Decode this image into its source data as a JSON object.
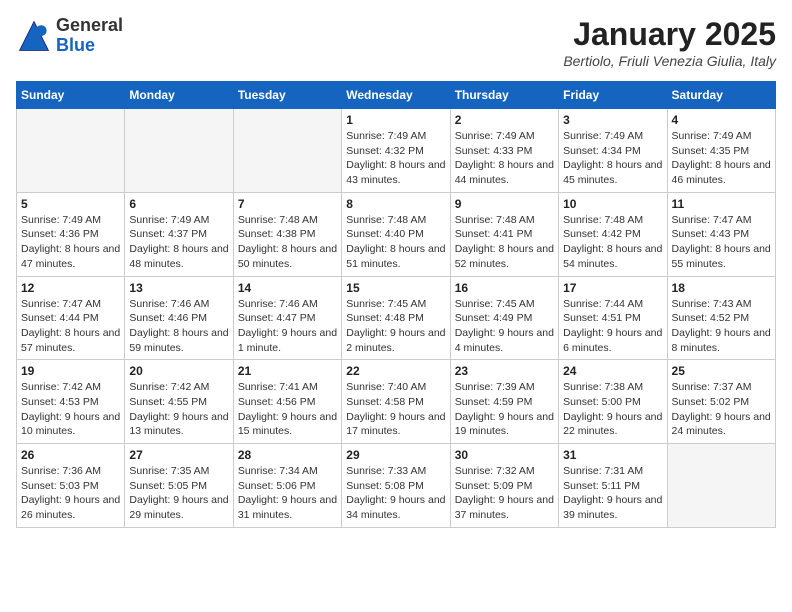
{
  "header": {
    "logo_general": "General",
    "logo_blue": "Blue",
    "month_title": "January 2025",
    "location": "Bertiolo, Friuli Venezia Giulia, Italy"
  },
  "days_of_week": [
    "Sunday",
    "Monday",
    "Tuesday",
    "Wednesday",
    "Thursday",
    "Friday",
    "Saturday"
  ],
  "weeks": [
    [
      {
        "day": "",
        "empty": true
      },
      {
        "day": "",
        "empty": true
      },
      {
        "day": "",
        "empty": true
      },
      {
        "day": "1",
        "sunrise": "7:49 AM",
        "sunset": "4:32 PM",
        "daylight": "8 hours and 43 minutes."
      },
      {
        "day": "2",
        "sunrise": "7:49 AM",
        "sunset": "4:33 PM",
        "daylight": "8 hours and 44 minutes."
      },
      {
        "day": "3",
        "sunrise": "7:49 AM",
        "sunset": "4:34 PM",
        "daylight": "8 hours and 45 minutes."
      },
      {
        "day": "4",
        "sunrise": "7:49 AM",
        "sunset": "4:35 PM",
        "daylight": "8 hours and 46 minutes."
      }
    ],
    [
      {
        "day": "5",
        "sunrise": "7:49 AM",
        "sunset": "4:36 PM",
        "daylight": "8 hours and 47 minutes."
      },
      {
        "day": "6",
        "sunrise": "7:49 AM",
        "sunset": "4:37 PM",
        "daylight": "8 hours and 48 minutes."
      },
      {
        "day": "7",
        "sunrise": "7:48 AM",
        "sunset": "4:38 PM",
        "daylight": "8 hours and 50 minutes."
      },
      {
        "day": "8",
        "sunrise": "7:48 AM",
        "sunset": "4:40 PM",
        "daylight": "8 hours and 51 minutes."
      },
      {
        "day": "9",
        "sunrise": "7:48 AM",
        "sunset": "4:41 PM",
        "daylight": "8 hours and 52 minutes."
      },
      {
        "day": "10",
        "sunrise": "7:48 AM",
        "sunset": "4:42 PM",
        "daylight": "8 hours and 54 minutes."
      },
      {
        "day": "11",
        "sunrise": "7:47 AM",
        "sunset": "4:43 PM",
        "daylight": "8 hours and 55 minutes."
      }
    ],
    [
      {
        "day": "12",
        "sunrise": "7:47 AM",
        "sunset": "4:44 PM",
        "daylight": "8 hours and 57 minutes."
      },
      {
        "day": "13",
        "sunrise": "7:46 AM",
        "sunset": "4:46 PM",
        "daylight": "8 hours and 59 minutes."
      },
      {
        "day": "14",
        "sunrise": "7:46 AM",
        "sunset": "4:47 PM",
        "daylight": "9 hours and 1 minute."
      },
      {
        "day": "15",
        "sunrise": "7:45 AM",
        "sunset": "4:48 PM",
        "daylight": "9 hours and 2 minutes."
      },
      {
        "day": "16",
        "sunrise": "7:45 AM",
        "sunset": "4:49 PM",
        "daylight": "9 hours and 4 minutes."
      },
      {
        "day": "17",
        "sunrise": "7:44 AM",
        "sunset": "4:51 PM",
        "daylight": "9 hours and 6 minutes."
      },
      {
        "day": "18",
        "sunrise": "7:43 AM",
        "sunset": "4:52 PM",
        "daylight": "9 hours and 8 minutes."
      }
    ],
    [
      {
        "day": "19",
        "sunrise": "7:42 AM",
        "sunset": "4:53 PM",
        "daylight": "9 hours and 10 minutes."
      },
      {
        "day": "20",
        "sunrise": "7:42 AM",
        "sunset": "4:55 PM",
        "daylight": "9 hours and 13 minutes."
      },
      {
        "day": "21",
        "sunrise": "7:41 AM",
        "sunset": "4:56 PM",
        "daylight": "9 hours and 15 minutes."
      },
      {
        "day": "22",
        "sunrise": "7:40 AM",
        "sunset": "4:58 PM",
        "daylight": "9 hours and 17 minutes."
      },
      {
        "day": "23",
        "sunrise": "7:39 AM",
        "sunset": "4:59 PM",
        "daylight": "9 hours and 19 minutes."
      },
      {
        "day": "24",
        "sunrise": "7:38 AM",
        "sunset": "5:00 PM",
        "daylight": "9 hours and 22 minutes."
      },
      {
        "day": "25",
        "sunrise": "7:37 AM",
        "sunset": "5:02 PM",
        "daylight": "9 hours and 24 minutes."
      }
    ],
    [
      {
        "day": "26",
        "sunrise": "7:36 AM",
        "sunset": "5:03 PM",
        "daylight": "9 hours and 26 minutes."
      },
      {
        "day": "27",
        "sunrise": "7:35 AM",
        "sunset": "5:05 PM",
        "daylight": "9 hours and 29 minutes."
      },
      {
        "day": "28",
        "sunrise": "7:34 AM",
        "sunset": "5:06 PM",
        "daylight": "9 hours and 31 minutes."
      },
      {
        "day": "29",
        "sunrise": "7:33 AM",
        "sunset": "5:08 PM",
        "daylight": "9 hours and 34 minutes."
      },
      {
        "day": "30",
        "sunrise": "7:32 AM",
        "sunset": "5:09 PM",
        "daylight": "9 hours and 37 minutes."
      },
      {
        "day": "31",
        "sunrise": "7:31 AM",
        "sunset": "5:11 PM",
        "daylight": "9 hours and 39 minutes."
      },
      {
        "day": "",
        "empty": true
      }
    ]
  ]
}
